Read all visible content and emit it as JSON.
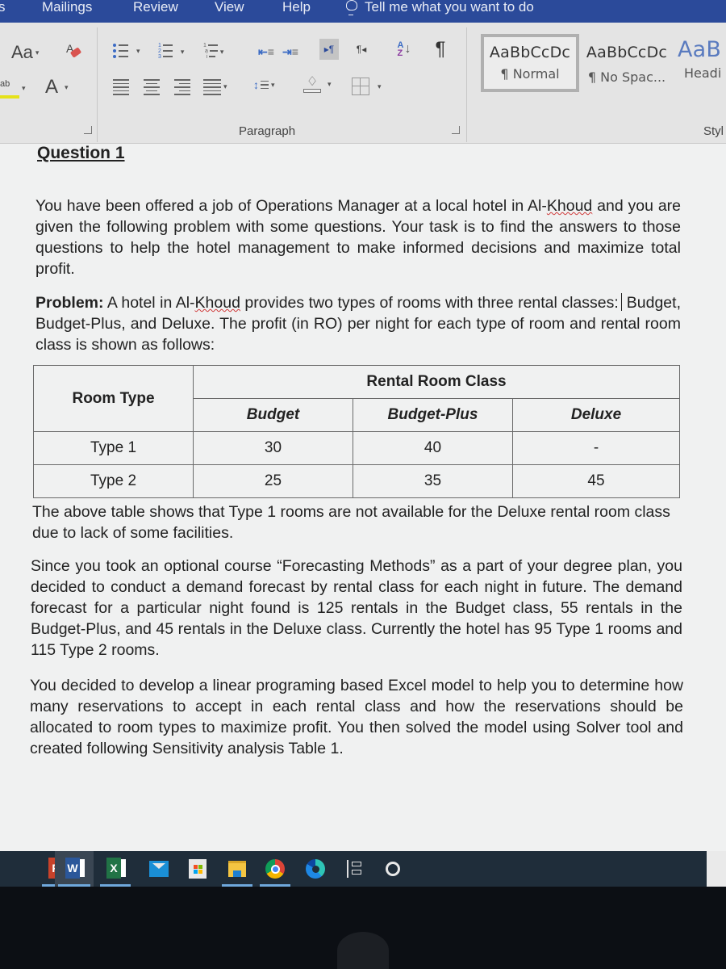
{
  "menubar": {
    "tabs": [
      "s",
      "Mailings",
      "Review",
      "View",
      "Help"
    ],
    "tell_me": "Tell me what you want to do"
  },
  "ribbon": {
    "font_group": {
      "change_case_label": "Aa",
      "font_color_label": "A",
      "highlight_label": "ab"
    },
    "paragraph_group": {
      "label": "Paragraph",
      "sort_label": "A↓Z",
      "show_marks_label": "¶",
      "ltr_label": "▸¶",
      "rtl_label": "¶◂"
    },
    "styles_group": {
      "label": "Styl",
      "styles": [
        {
          "sample": "AaBbCcDc",
          "name": "¶ Normal",
          "selected": true
        },
        {
          "sample": "AaBbCcDc",
          "name": "¶ No Spac...",
          "selected": false
        },
        {
          "sample": "AaB",
          "name": "Headi",
          "selected": false
        }
      ]
    }
  },
  "document": {
    "heading": "Question 1",
    "intro": {
      "before": "You have been offered a job of Operations Manager at a local hotel in Al-",
      "misspelled": "Khoud",
      "after": " and you are given the following problem with some questions. Your task is to find the answers to those questions to help the hotel management to make informed decisions and maximize total profit."
    },
    "problem": {
      "label": "Problem:",
      "before": " A hotel in Al-",
      "misspelled": "Khoud",
      "after": " provides two types of rooms with three rental classes: Budget, Budget-Plus, and Deluxe. The profit (in RO) per night for each type of room and rental room class is shown as follows:"
    },
    "profit_table": {
      "group_header": "Rental Room Class",
      "row_header": "Room Type",
      "columns": [
        "Budget",
        "Budget-Plus",
        "Deluxe"
      ],
      "rows": [
        {
          "type": "Type 1",
          "values": [
            "30",
            "40",
            "-"
          ]
        },
        {
          "type": "Type 2",
          "values": [
            "25",
            "35",
            "45"
          ]
        }
      ]
    },
    "table_note": "The above table shows that Type 1 rooms are not available for the Deluxe rental room class due to lack of some facilities.",
    "forecast": "Since you took an optional course “Forecasting Methods” as a part of your degree plan, you decided to conduct a demand forecast by rental class for each night in future. The demand forecast for a particular night found is 125 rentals in the Budget class, 55 rentals in the Budget-Plus, and 45 rentals in the Deluxe class. Currently the hotel has 95 Type 1 rooms and 115 Type 2 rooms.",
    "model": "You decided to develop a linear programing based Excel model to help you to determine how many reservations to accept in each rental class and how the reservations should be allocated to room types to maximize profit. You then solved the model using Solver tool and created following Sensitivity analysis Table 1."
  },
  "taskbar": {
    "apps": [
      {
        "name": "PowerPoint",
        "letter": "P",
        "color": "#c9422a",
        "running": true
      },
      {
        "name": "Word",
        "letter": "W",
        "color": "#2b579a",
        "running": true,
        "active": true
      },
      {
        "name": "Excel",
        "letter": "X",
        "color": "#217346",
        "running": true
      },
      {
        "name": "Mail",
        "running": false
      },
      {
        "name": "Microsoft Store",
        "running": false
      },
      {
        "name": "File Explorer",
        "running": true
      },
      {
        "name": "Chrome",
        "running": true
      },
      {
        "name": "Edge",
        "running": false
      },
      {
        "name": "Task View",
        "running": false
      },
      {
        "name": "Cortana",
        "running": false
      }
    ]
  }
}
